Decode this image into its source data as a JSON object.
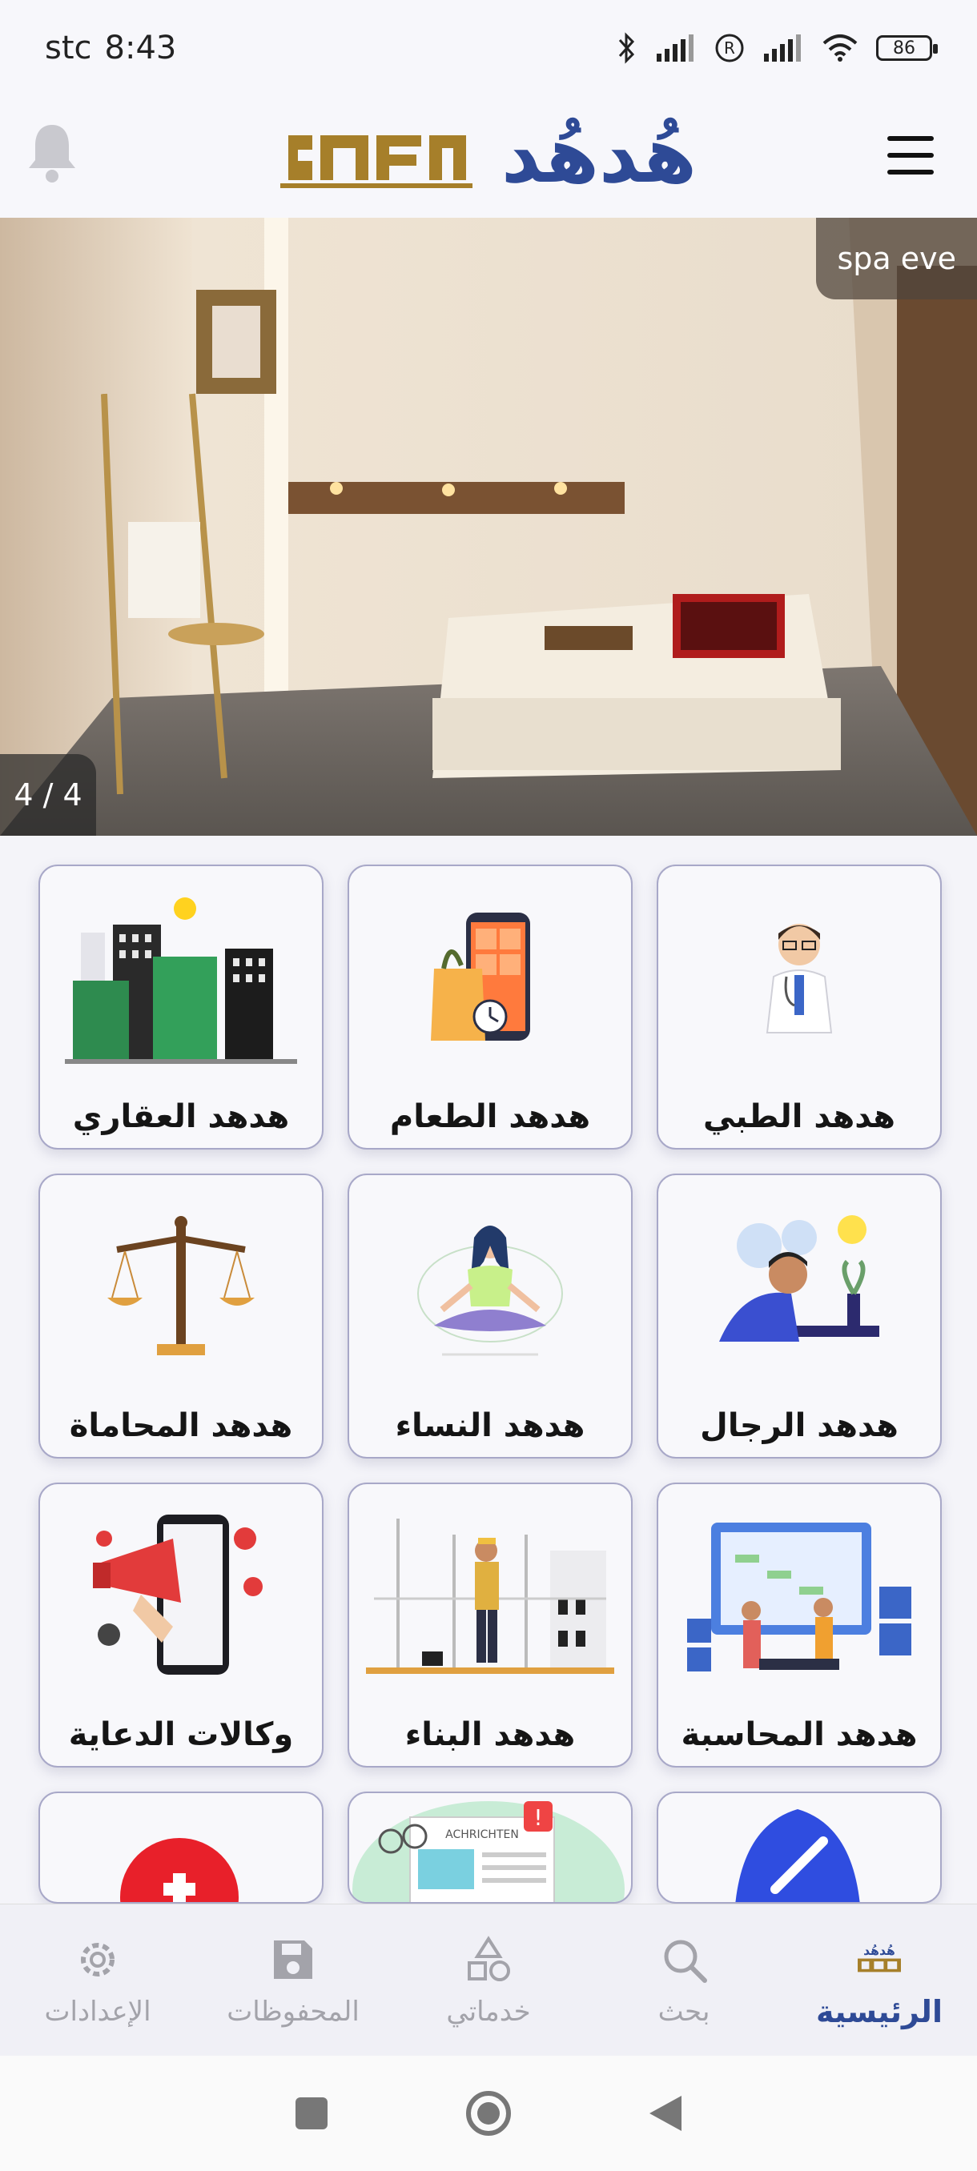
{
  "status_bar": {
    "carrier": "stc",
    "time": "8:43",
    "battery": "86",
    "icons": [
      "bluetooth-icon",
      "signal-icon",
      "registered-icon",
      "signal-icon",
      "wifi-icon",
      "battery-icon"
    ]
  },
  "header": {
    "logo_text": "هُدهُد",
    "menu_icon": "hamburger-menu-icon",
    "bell_icon": "bell-icon",
    "brand_color": "#2e4a96",
    "gold_color": "#a67f2a"
  },
  "banner": {
    "badge": "spa eve",
    "counter": "4 / 4"
  },
  "services": [
    {
      "label": "هدهد الطبي",
      "icon": "doctor-illustration"
    },
    {
      "label": "هدهد الطعام",
      "icon": "food-delivery-illustration"
    },
    {
      "label": "هدهد العقاري",
      "icon": "real-estate-buildings-illustration"
    },
    {
      "label": "هدهد الرجال",
      "icon": "thinking-man-illustration"
    },
    {
      "label": "هدهد النساء",
      "icon": "meditating-woman-illustration"
    },
    {
      "label": "هدهد المحاماة",
      "icon": "justice-scales-illustration"
    },
    {
      "label": "هدهد المحاسبة",
      "icon": "accounting-dashboard-illustration"
    },
    {
      "label": "هدهد البناء",
      "icon": "construction-worker-illustration"
    },
    {
      "label": "وكالات الدعاية",
      "icon": "social-media-megaphone-illustration"
    }
  ],
  "partial_cards": {
    "news_text": "ACHRICHTEN"
  },
  "bottom_nav": [
    {
      "label": "الرئيسية",
      "icon": "home-logo-icon",
      "active": true
    },
    {
      "label": "بحث",
      "icon": "search-icon",
      "active": false
    },
    {
      "label": "خدماتي",
      "icon": "shapes-icon",
      "active": false
    },
    {
      "label": "المحفوظات",
      "icon": "save-icon",
      "active": false
    },
    {
      "label": "الإعدادات",
      "icon": "gear-icon",
      "active": false
    }
  ]
}
